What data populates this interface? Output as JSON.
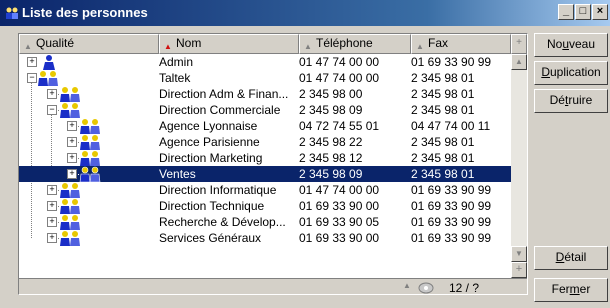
{
  "window": {
    "title": "Liste des personnes",
    "min_glyph": "_",
    "max_glyph": "□",
    "close_glyph": "×"
  },
  "columns": {
    "qualite": "Qualité",
    "nom": "Nom",
    "telephone": "Téléphone",
    "fax": "Fax"
  },
  "rows": [
    {
      "nom": "Admin",
      "tel": "01 47 74 00 00",
      "fax": "01 69 33 90 99",
      "level": 0,
      "expander": "+",
      "icon": "person-icon",
      "selected": false
    },
    {
      "nom": "Taltek",
      "tel": "01 47 74 00 00",
      "fax": "2 345 98 01",
      "level": 0,
      "expander": "−",
      "icon": "group-icon",
      "selected": false
    },
    {
      "nom": "Direction Adm & Finan...",
      "tel": "2 345 98 00",
      "fax": "2 345 98 01",
      "level": 1,
      "expander": "+",
      "icon": "group-icon",
      "selected": false
    },
    {
      "nom": "Direction Commerciale",
      "tel": "2 345 98 09",
      "fax": "2 345 98 01",
      "level": 1,
      "expander": "−",
      "icon": "group-icon",
      "selected": false
    },
    {
      "nom": "Agence Lyonnaise",
      "tel": "04 72 74 55 01",
      "fax": "04 47 74 00 11",
      "level": 2,
      "expander": "+",
      "icon": "group-icon",
      "selected": false
    },
    {
      "nom": "Agence Parisienne",
      "tel": "2 345 98 22",
      "fax": "2 345 98 01",
      "level": 2,
      "expander": "+",
      "icon": "group-icon",
      "selected": false
    },
    {
      "nom": "Direction Marketing",
      "tel": "2 345 98 12",
      "fax": "2 345 98 01",
      "level": 2,
      "expander": "+",
      "icon": "group-icon",
      "selected": false
    },
    {
      "nom": "Ventes",
      "tel": "2 345 98 09",
      "fax": "2 345 98 01",
      "level": 2,
      "expander": "+",
      "icon": "group-icon",
      "selected": true
    },
    {
      "nom": "Direction Informatique",
      "tel": "01 47 74 00 00",
      "fax": "01 69 33 90 99",
      "level": 1,
      "expander": "+",
      "icon": "group-icon",
      "selected": false
    },
    {
      "nom": "Direction Technique",
      "tel": "01 69 33 90 00",
      "fax": "01 69 33 90 99",
      "level": 1,
      "expander": "+",
      "icon": "group-icon",
      "selected": false
    },
    {
      "nom": "Recherche & Dévelop...",
      "tel": "01 69 33 90 05",
      "fax": "01 69 33 90 99",
      "level": 1,
      "expander": "+",
      "icon": "group-icon",
      "selected": false
    },
    {
      "nom": "Services Généraux",
      "tel": "01 69 33 90 00",
      "fax": "01 69 33 90 99",
      "level": 1,
      "expander": "+",
      "icon": "group-icon",
      "selected": false
    }
  ],
  "status": {
    "counter": "12 / ?"
  },
  "buttons": {
    "nouveau": {
      "pre": "No",
      "acc": "u",
      "post": "veau"
    },
    "duplication": {
      "pre": "",
      "acc": "D",
      "post": "uplication"
    },
    "detruire": {
      "pre": "Dé",
      "acc": "t",
      "post": "ruire"
    },
    "detail": {
      "pre": "",
      "acc": "D",
      "post": "étail"
    },
    "fermer": {
      "pre": "Fer",
      "acc": "m",
      "post": "er"
    }
  },
  "colors": {
    "title_start": "#0a246a",
    "selection": "#0a246a",
    "person_body": "#1a2ec8",
    "group_head": "#e8c800"
  }
}
